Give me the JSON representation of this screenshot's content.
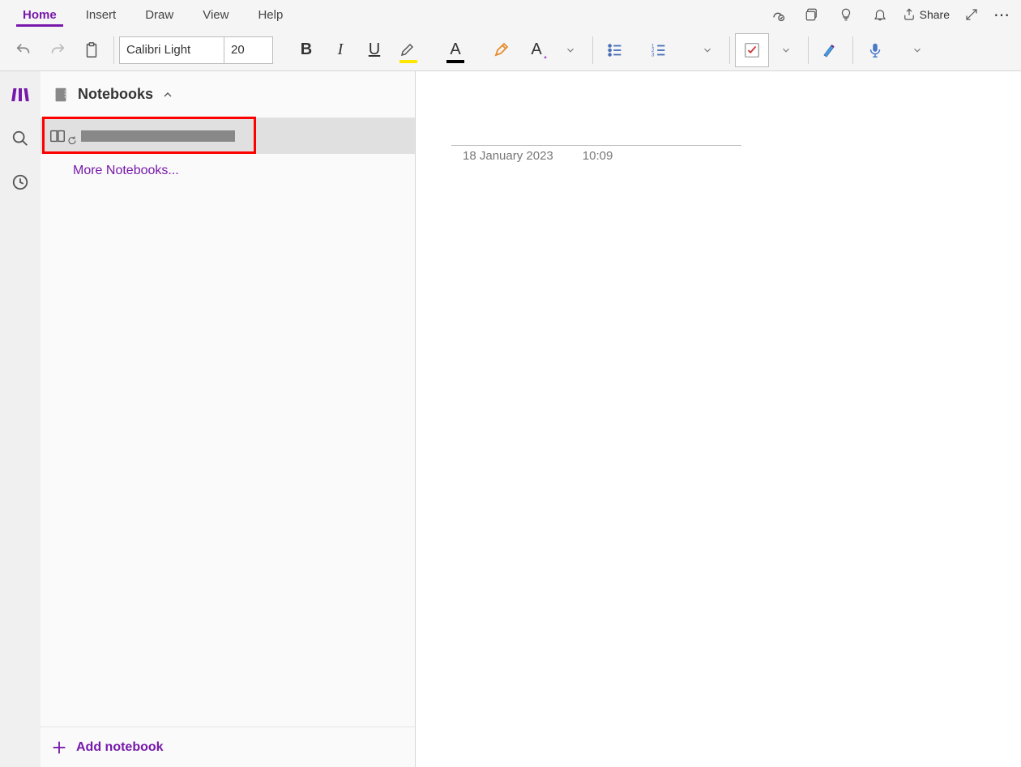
{
  "menu": {
    "home": "Home",
    "insert": "Insert",
    "draw": "Draw",
    "view": "View",
    "help": "Help",
    "share": "Share"
  },
  "toolbar": {
    "font_name": "Calibri Light",
    "font_size": "20"
  },
  "sidebar": {
    "title": "Notebooks",
    "more": "More Notebooks...",
    "add": "Add notebook"
  },
  "page": {
    "date": "18 January 2023",
    "time": "10:09"
  }
}
